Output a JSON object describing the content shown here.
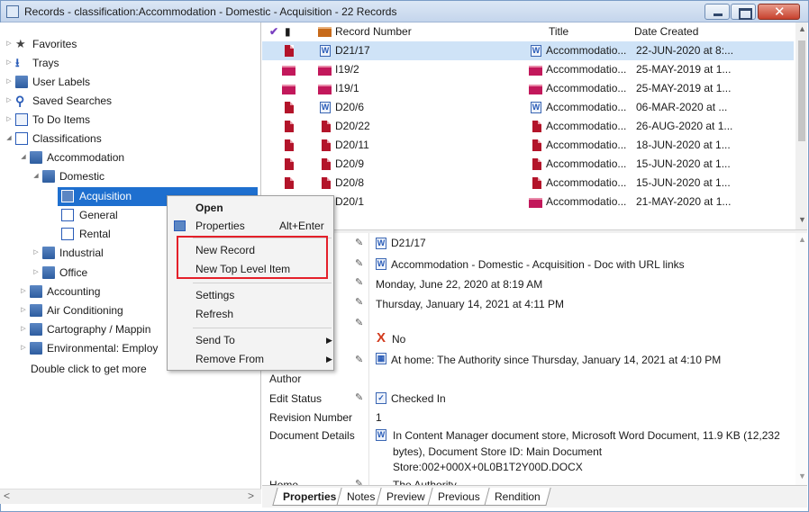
{
  "window": {
    "title": "Records - classification:Accommodation - Domestic - Acquisition - 22 Records"
  },
  "tree": {
    "items": [
      {
        "label": "Favorites",
        "icon": "star-icon",
        "expanded": false
      },
      {
        "label": "Trays",
        "icon": "tray-icon",
        "expanded": false
      },
      {
        "label": "User Labels",
        "icon": "label-icon",
        "expanded": false
      },
      {
        "label": "Saved Searches",
        "icon": "search-icon",
        "expanded": false
      },
      {
        "label": "To Do Items",
        "icon": "todo-icon",
        "expanded": false
      },
      {
        "label": "Classifications",
        "icon": "classification-icon",
        "expanded": true
      },
      {
        "label": "Accommodation",
        "icon": "folder-icon",
        "expanded": true
      },
      {
        "label": "Domestic",
        "icon": "folder-icon",
        "expanded": true
      },
      {
        "label": "Acquisition",
        "icon": "classification-leaf-icon",
        "selected": true
      },
      {
        "label": "General",
        "icon": "classification-leaf-icon"
      },
      {
        "label": "Rental",
        "icon": "classification-leaf-icon"
      },
      {
        "label": "Industrial",
        "icon": "folder-icon",
        "expanded": false
      },
      {
        "label": "Office",
        "icon": "folder-icon",
        "expanded": false
      },
      {
        "label": "Accounting",
        "icon": "folder-icon",
        "expanded": false
      },
      {
        "label": "Air Conditioning",
        "icon": "folder-icon",
        "expanded": false
      },
      {
        "label": "Cartography / Mappin",
        "icon": "folder-icon",
        "expanded": false
      },
      {
        "label": "Environmental: Employ",
        "icon": "folder-icon",
        "expanded": false
      }
    ],
    "hint": "Double click to get more"
  },
  "list": {
    "headers": {
      "number": "Record Number",
      "title": "Title",
      "date": "Date Created"
    },
    "rows": [
      {
        "number": "D21/17",
        "title": "Accommodatio...",
        "date": "22-JUN-2020 at 8:..."
      },
      {
        "number": "I19/2",
        "title": "Accommodatio...",
        "date": "25-MAY-2019 at 1..."
      },
      {
        "number": "I19/1",
        "title": "Accommodatio...",
        "date": "25-MAY-2019 at 1..."
      },
      {
        "number": "D20/6",
        "title": "Accommodatio...",
        "date": "06-MAR-2020 at ..."
      },
      {
        "number": "D20/22",
        "title": "Accommodatio...",
        "date": "26-AUG-2020 at 1..."
      },
      {
        "number": "D20/11",
        "title": "Accommodatio...",
        "date": "18-JUN-2020 at 1..."
      },
      {
        "number": "D20/9",
        "title": "Accommodatio...",
        "date": "15-JUN-2020 at 1..."
      },
      {
        "number": "D20/8",
        "title": "Accommodatio...",
        "date": "15-JUN-2020 at 1..."
      },
      {
        "number": "D20/1",
        "title": "Accommodatio...",
        "date": "21-MAY-2020 at 1..."
      }
    ]
  },
  "props": {
    "number": "D21/17",
    "title": "Accommodation - Domestic - Acquisition - Doc with URL links",
    "date_created": "Monday, June 22, 2020 at 8:19 AM",
    "date_registered": "Thursday, January 14, 2021 at 4:11 PM",
    "enclosed": "No",
    "location": "At home: The Authority since Thursday, January 14, 2021 at 4:10 PM",
    "labels": {
      "author": "Author",
      "edit_status": "Edit Status",
      "revision": "Revision Number",
      "doc_details": "Document Details",
      "home": "Home"
    },
    "edit_status": "Checked In",
    "revision": "1",
    "doc_details_1": "In Content Manager document store, Microsoft Word Document, 11.9 KB (12,232",
    "doc_details_2": "bytes), Document Store ID: Main Document",
    "doc_details_3": "Store:002+000X+0L0B1T2Y00D.DOCX",
    "home": "The Authority"
  },
  "tabs": [
    "Properties",
    "Notes",
    "Preview",
    "Previous",
    "Rendition"
  ],
  "menu": {
    "open": "Open",
    "properties": "Properties",
    "properties_shortcut": "Alt+Enter",
    "new_record": "New Record",
    "new_top_level": "New Top Level Item",
    "settings": "Settings",
    "refresh": "Refresh",
    "send_to": "Send To",
    "remove_from": "Remove From"
  },
  "colors": {
    "selection": "#1e6fcf",
    "highlight_box": "#e4202a",
    "row_selected": "#cfe3f7"
  }
}
